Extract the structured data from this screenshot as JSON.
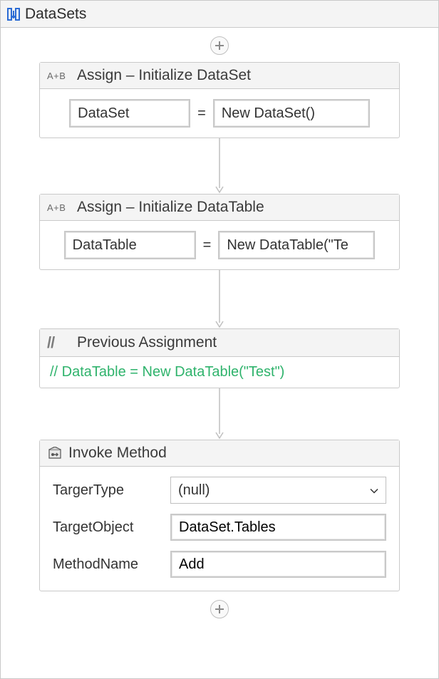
{
  "sequence": {
    "title": "DataSets"
  },
  "activities": {
    "assign1": {
      "badge": "A+B",
      "title": "Assign – Initialize DataSet",
      "left": "DataSet",
      "right": "New DataSet()"
    },
    "assign2": {
      "badge": "A+B",
      "title": "Assign – Initialize DataTable",
      "left": "DataTable",
      "right": "New DataTable(\"Te"
    },
    "comment": {
      "title": "Previous Assignment",
      "text": "// DataTable = New DataTable(\"Test\")"
    },
    "invoke": {
      "title": "Invoke Method",
      "fields": {
        "targetTypeLabel": "TargerType",
        "targetType": "(null)",
        "targetObjectLabel": "TargetObject",
        "targetObject": "DataSet.Tables",
        "methodNameLabel": "MethodName",
        "methodName": "Add"
      }
    }
  }
}
